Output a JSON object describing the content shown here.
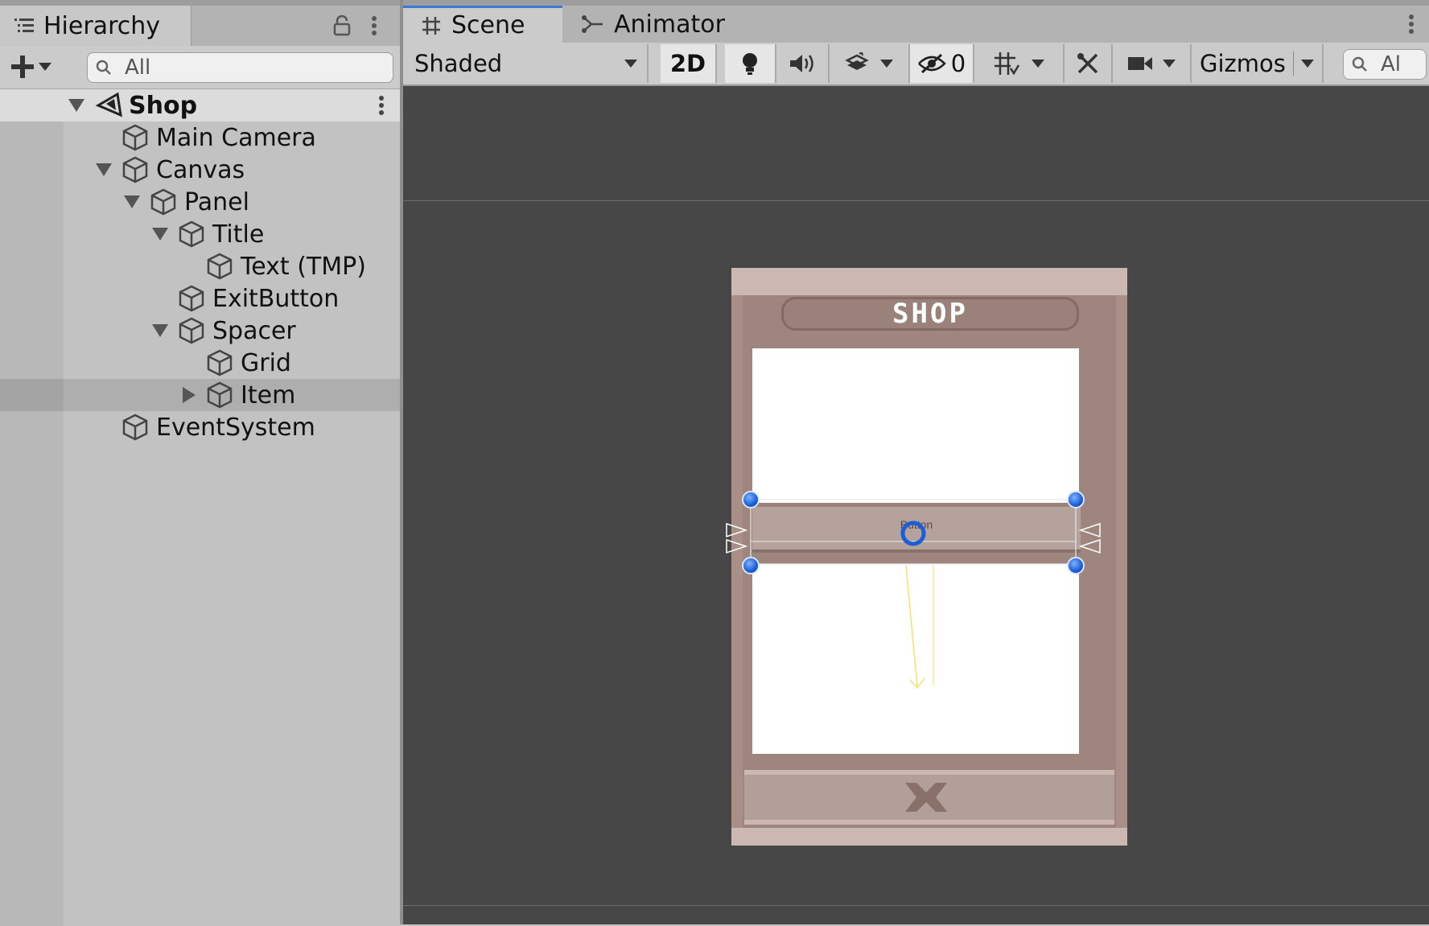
{
  "hierarchy": {
    "tab_label": "Hierarchy",
    "search_placeholder": "All",
    "scene_name": "Shop",
    "items": [
      {
        "label": "Main Camera"
      },
      {
        "label": "Canvas"
      },
      {
        "label": "Panel"
      },
      {
        "label": "Title"
      },
      {
        "label": "Text (TMP)"
      },
      {
        "label": "ExitButton"
      },
      {
        "label": "Spacer"
      },
      {
        "label": "Grid"
      },
      {
        "label": "Item"
      },
      {
        "label": "EventSystem"
      }
    ],
    "selected_item": "Item"
  },
  "scene_view": {
    "tabs": [
      {
        "label": "Scene",
        "active": true
      },
      {
        "label": "Animator",
        "active": false
      }
    ],
    "toolbar": {
      "shading_mode": "Shaded",
      "mode_2d_label": "2D",
      "hidden_count": "0",
      "gizmos_label": "Gizmos",
      "search_placeholder": "Al"
    },
    "canvas": {
      "title_text": "SHOP",
      "button_text": "Button"
    }
  },
  "colors": {
    "accent": "#3a79d6",
    "viewport_bg": "#474747",
    "panel_bg": "#c2c2c2",
    "frame": "#a98f88"
  },
  "icons": [
    "hierarchy-list-icon",
    "lock-icon",
    "kebab-menu-icon",
    "plus-icon",
    "search-icon",
    "unity-scene-icon",
    "gameobject-cube-icon",
    "grid-icon",
    "animator-icon",
    "lightbulb-icon",
    "audio-icon",
    "effects-icon",
    "visibility-icon",
    "grid-snap-icon",
    "tools-icon",
    "camera-icon"
  ]
}
